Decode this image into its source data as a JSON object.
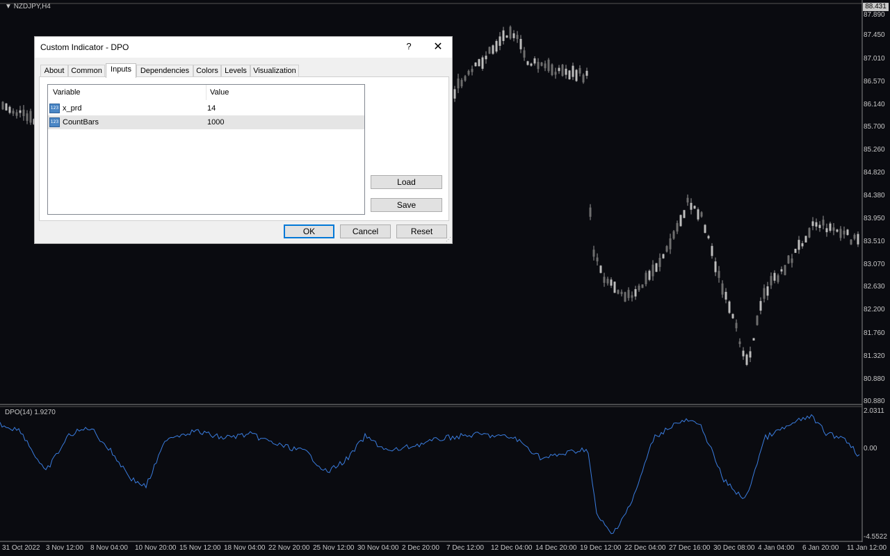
{
  "chart": {
    "symbol": "NZDJPY,H4",
    "current_price": "88.431",
    "price_ticks": [
      "87.890",
      "87.450",
      "87.010",
      "86.570",
      "86.140",
      "85.700",
      "85.260",
      "84.820",
      "84.380",
      "83.950",
      "83.510",
      "83.070",
      "82.630",
      "82.200",
      "81.760",
      "81.320",
      "80.880"
    ],
    "indicator_label": "DPO(14) 1.9270",
    "indicator_ticks": [
      "2.0311",
      "0.00",
      "-4.5522"
    ],
    "time_ticks": [
      "31 Oct 2022",
      "3 Nov 12:00",
      "8 Nov 04:00",
      "10 Nov 20:00",
      "15 Nov 12:00",
      "18 Nov 04:00",
      "22 Nov 20:00",
      "25 Nov 12:00",
      "30 Nov 04:00",
      "2 Dec 20:00",
      "7 Dec 12:00",
      "12 Dec 04:00",
      "14 Dec 20:00",
      "19 Dec 12:00",
      "22 Dec 04:00",
      "27 Dec 16:00",
      "30 Dec 08:00",
      "4 Jan 04:00",
      "6 Jan 20:00",
      "11 Jan 12:00"
    ],
    "colors": {
      "background": "#0a0b10",
      "candle": "#9a9a9a",
      "indicator_line": "#3a7de0",
      "axis_text": "#c8c8c8"
    }
  },
  "dialog": {
    "title": "Custom Indicator - DPO",
    "help_label": "?",
    "close_label": "✕",
    "tabs": [
      {
        "label": "About"
      },
      {
        "label": "Common"
      },
      {
        "label": "Inputs"
      },
      {
        "label": "Dependencies"
      },
      {
        "label": "Colors"
      },
      {
        "label": "Levels"
      },
      {
        "label": "Visualization"
      }
    ],
    "active_tab": "Inputs",
    "table": {
      "headers": {
        "variable": "Variable",
        "value": "Value"
      },
      "rows": [
        {
          "icon": "123",
          "variable": "x_prd",
          "value": "14"
        },
        {
          "icon": "123",
          "variable": "CountBars",
          "value": "1000"
        }
      ]
    },
    "buttons": {
      "load": "Load",
      "save": "Save",
      "ok": "OK",
      "cancel": "Cancel",
      "reset": "Reset"
    }
  }
}
